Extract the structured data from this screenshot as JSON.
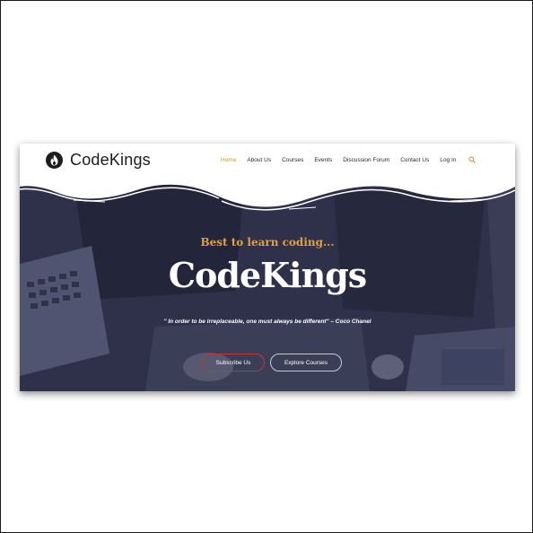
{
  "brand": {
    "name": "CodeKings",
    "logo_icon": "flame-icon"
  },
  "nav": {
    "items": [
      {
        "label": "Home",
        "active": true
      },
      {
        "label": "About Us",
        "active": false
      },
      {
        "label": "Courses",
        "active": false
      },
      {
        "label": "Events",
        "active": false
      },
      {
        "label": "Discussion Forum",
        "active": false
      },
      {
        "label": "Contact Us",
        "active": false
      },
      {
        "label": "Log In",
        "active": false
      }
    ],
    "search_icon": "search-icon",
    "active_color": "#d4941e"
  },
  "hero": {
    "tagline": "Best to learn coding...",
    "title": "CodeKings",
    "quote": "\" In order to be irreplaceable, one must always be different\" – Coco Chanel",
    "buttons": {
      "subscribe": "Subscribe Us",
      "explore": "Explore Courses"
    },
    "colors": {
      "overlay": "#2b2e46",
      "tagline": "#e0a23c",
      "subscribe_border": "#c0392b"
    }
  }
}
